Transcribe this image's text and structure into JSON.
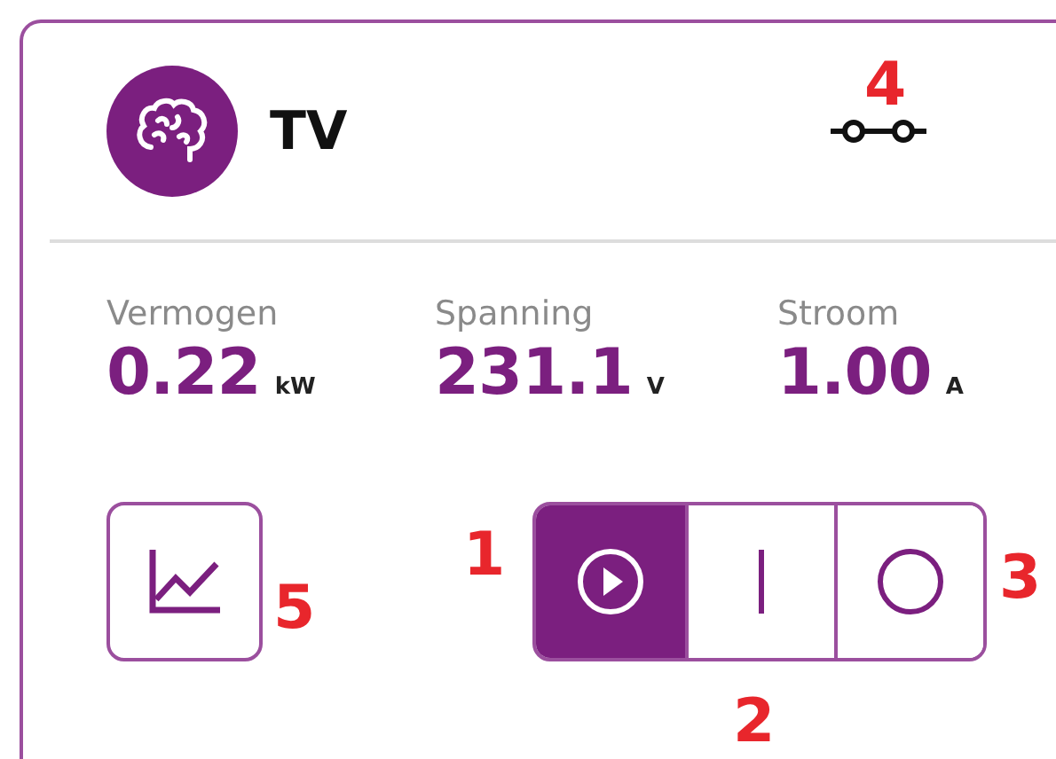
{
  "device": {
    "title": "TV",
    "connection_annotation": "4"
  },
  "metrics": [
    {
      "label": "Vermogen",
      "value": "0.22",
      "unit": "kW"
    },
    {
      "label": "Spanning",
      "value": "231.1",
      "unit": "V"
    },
    {
      "label": "Stroom",
      "value": "1.00",
      "unit": "A"
    }
  ],
  "chart_button": {
    "annotation": "5"
  },
  "modes": [
    {
      "kind": "auto",
      "selected": true,
      "annotation": "1"
    },
    {
      "kind": "on",
      "selected": false,
      "annotation": "2"
    },
    {
      "kind": "off",
      "selected": false,
      "annotation": "3"
    }
  ]
}
